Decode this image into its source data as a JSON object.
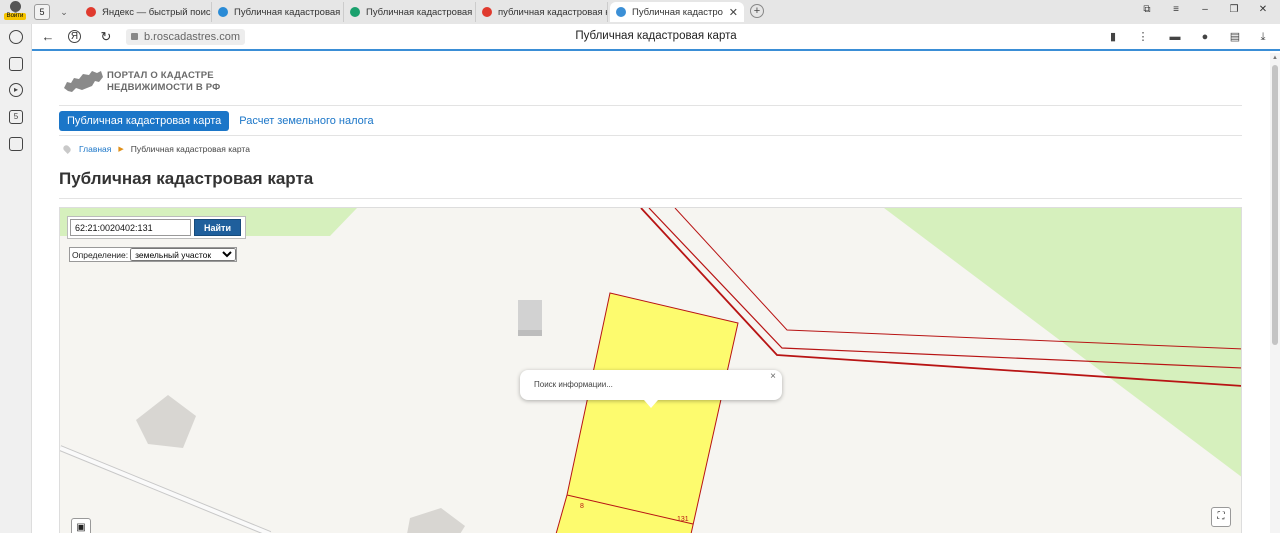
{
  "browser": {
    "profile_label": "Войти",
    "tab_count": "5",
    "tabs": [
      {
        "title": "Яндекс — быстрый поиск",
        "color": "#e03a2e"
      },
      {
        "title": "Публичная кадастровая карта",
        "color": "#2a8bd6"
      },
      {
        "title": "Публичная кадастровая карта",
        "color": "#1aa06d"
      },
      {
        "title": "публичная кадастровая карта",
        "color": "#e03a2e"
      },
      {
        "title": "Публичная кадастровая карта",
        "color": "#3b8fd6"
      }
    ],
    "url": "b.roscadastres.com",
    "page_title": "Публичная кадастровая карта",
    "accent": "#3a8ed6"
  },
  "site": {
    "logo_line1": "ПОРТАЛ О КАДАСТРЕ",
    "logo_line2": "НЕДВИЖИМОСТИ В РФ",
    "nav": {
      "active": "Публичная кадастровая карта",
      "other": "Расчет земельного налога"
    },
    "breadcrumb": {
      "home": "Главная",
      "current": "Публичная кадастровая карта"
    },
    "heading": "Публичная кадастровая карта",
    "accent": "#1b76c8"
  },
  "map": {
    "search_value": "62:21:0020402:131",
    "search_button": "Найти",
    "definition_label": "Определение:",
    "definition_value": "земельный участок",
    "popup_text": "Поиск информации...",
    "popup_close": "×",
    "parcel_label_a": "8",
    "parcel_label_b": "131",
    "parcel_color": "#fdfb6e",
    "boundary_color": "#b81414",
    "green_color": "#d6f0bd"
  }
}
